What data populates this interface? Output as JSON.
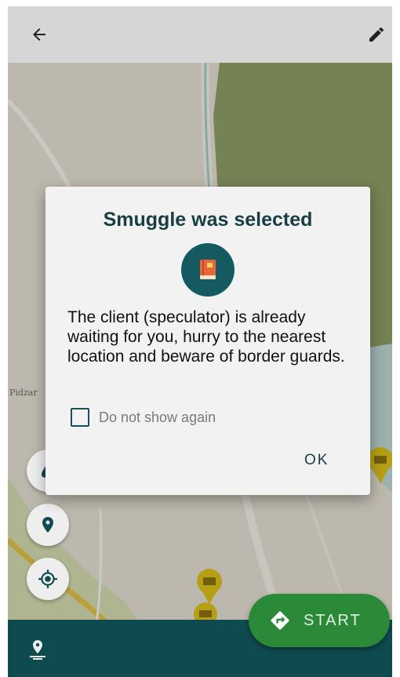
{
  "topbar": {
    "back_icon": "arrow-left-icon",
    "edit_icon": "pencil-icon"
  },
  "map": {
    "place_label": "Pidzar"
  },
  "dialog": {
    "title": "Smuggle was selected",
    "badge_icon": "book-icon",
    "message": "The client (speculator) is already waiting for you, hurry to the nearest location and beware of border guards.",
    "checkbox_label": "Do not show again",
    "checkbox_checked": false,
    "ok_label": "OK"
  },
  "side_buttons": [
    {
      "name": "money-bag-icon"
    },
    {
      "name": "location-pin-icon"
    },
    {
      "name": "my-location-icon"
    }
  ],
  "start_button": {
    "label": "START",
    "icon": "directions-icon"
  },
  "bottombar": {
    "icon": "place-marker-icon"
  },
  "colors": {
    "primary_dark": "#0f4a4f",
    "accent_green": "#2a8a37",
    "marker_yellow": "#e0c21a"
  }
}
